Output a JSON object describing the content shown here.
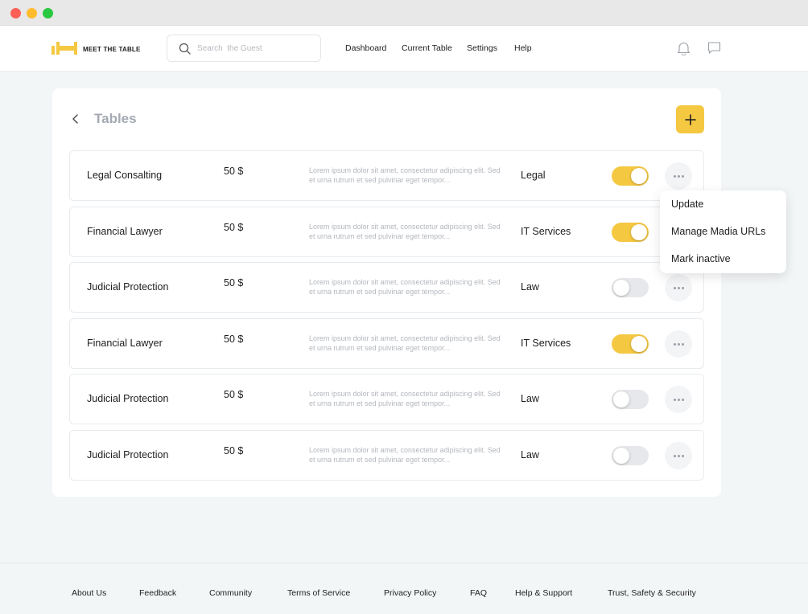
{
  "app": {
    "logo_text": "MEET THE TABLE",
    "brand_color": "#f5c842"
  },
  "search": {
    "placeholder": "Search  the Guest"
  },
  "nav": [
    "Dashboard",
    "Current Table",
    "Settings",
    "Help"
  ],
  "header_icons": [
    "bell-icon",
    "chat-icon"
  ],
  "page": {
    "title": "Tables",
    "back_icon": "chevron-left-icon",
    "add_icon": "plus-icon"
  },
  "rows": [
    {
      "name": "Legal Consalting",
      "price": "50 $",
      "desc": "Lorem ipsum dolor sit amet, consectetur adipiscing elit. Sed et urna rutrum et sed pulvinar eget tempor...",
      "category": "Legal",
      "active": true
    },
    {
      "name": "Financial Lawyer",
      "price": "50 $",
      "desc": "Lorem ipsum dolor sit amet, consectetur adipiscing elit. Sed et urna rutrum et sed pulvinar eget tempor...",
      "category": "IT Services",
      "active": true
    },
    {
      "name": "Judicial Protection",
      "price": "50 $",
      "desc": "Lorem ipsum dolor sit amet, consectetur adipiscing elit. Sed et urna rutrum et sed pulvinar eget tempor...",
      "category": "Law",
      "active": false
    },
    {
      "name": "Financial Lawyer",
      "price": "50 $",
      "desc": "Lorem ipsum dolor sit amet, consectetur adipiscing elit. Sed et urna rutrum et sed pulvinar eget tempor...",
      "category": "IT Services",
      "active": true
    },
    {
      "name": "Judicial Protection",
      "price": "50 $",
      "desc": "Lorem ipsum dolor sit amet, consectetur adipiscing elit. Sed et urna rutrum et sed pulvinar eget tempor...",
      "category": "Law",
      "active": false
    },
    {
      "name": "Judicial Protection",
      "price": "50 $",
      "desc": "Lorem ipsum dolor sit amet, consectetur adipiscing elit. Sed et urna rutrum et sed pulvinar eget tempor...",
      "category": "Law",
      "active": false
    }
  ],
  "context_menu": [
    "Update",
    "Manage Madia URLs",
    "Mark inactive"
  ],
  "footer": {
    "links": [
      "About Us",
      "Feedback",
      "Community",
      "Terms of Service",
      "Privacy Policy",
      "FAQ",
      "Help & Support",
      "Trust, Safety & Security"
    ]
  }
}
